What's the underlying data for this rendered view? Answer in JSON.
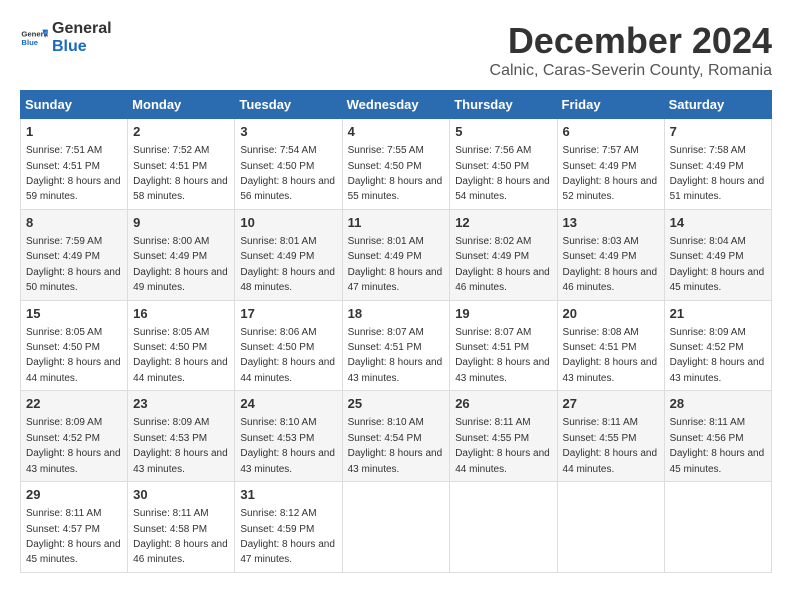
{
  "header": {
    "logo_general": "General",
    "logo_blue": "Blue",
    "month_title": "December 2024",
    "subtitle": "Calnic, Caras-Severin County, Romania"
  },
  "days_of_week": [
    "Sunday",
    "Monday",
    "Tuesday",
    "Wednesday",
    "Thursday",
    "Friday",
    "Saturday"
  ],
  "weeks": [
    [
      {
        "day": "1",
        "sunrise": "Sunrise: 7:51 AM",
        "sunset": "Sunset: 4:51 PM",
        "daylight": "Daylight: 8 hours and 59 minutes."
      },
      {
        "day": "2",
        "sunrise": "Sunrise: 7:52 AM",
        "sunset": "Sunset: 4:51 PM",
        "daylight": "Daylight: 8 hours and 58 minutes."
      },
      {
        "day": "3",
        "sunrise": "Sunrise: 7:54 AM",
        "sunset": "Sunset: 4:50 PM",
        "daylight": "Daylight: 8 hours and 56 minutes."
      },
      {
        "day": "4",
        "sunrise": "Sunrise: 7:55 AM",
        "sunset": "Sunset: 4:50 PM",
        "daylight": "Daylight: 8 hours and 55 minutes."
      },
      {
        "day": "5",
        "sunrise": "Sunrise: 7:56 AM",
        "sunset": "Sunset: 4:50 PM",
        "daylight": "Daylight: 8 hours and 54 minutes."
      },
      {
        "day": "6",
        "sunrise": "Sunrise: 7:57 AM",
        "sunset": "Sunset: 4:49 PM",
        "daylight": "Daylight: 8 hours and 52 minutes."
      },
      {
        "day": "7",
        "sunrise": "Sunrise: 7:58 AM",
        "sunset": "Sunset: 4:49 PM",
        "daylight": "Daylight: 8 hours and 51 minutes."
      }
    ],
    [
      {
        "day": "8",
        "sunrise": "Sunrise: 7:59 AM",
        "sunset": "Sunset: 4:49 PM",
        "daylight": "Daylight: 8 hours and 50 minutes."
      },
      {
        "day": "9",
        "sunrise": "Sunrise: 8:00 AM",
        "sunset": "Sunset: 4:49 PM",
        "daylight": "Daylight: 8 hours and 49 minutes."
      },
      {
        "day": "10",
        "sunrise": "Sunrise: 8:01 AM",
        "sunset": "Sunset: 4:49 PM",
        "daylight": "Daylight: 8 hours and 48 minutes."
      },
      {
        "day": "11",
        "sunrise": "Sunrise: 8:01 AM",
        "sunset": "Sunset: 4:49 PM",
        "daylight": "Daylight: 8 hours and 47 minutes."
      },
      {
        "day": "12",
        "sunrise": "Sunrise: 8:02 AM",
        "sunset": "Sunset: 4:49 PM",
        "daylight": "Daylight: 8 hours and 46 minutes."
      },
      {
        "day": "13",
        "sunrise": "Sunrise: 8:03 AM",
        "sunset": "Sunset: 4:49 PM",
        "daylight": "Daylight: 8 hours and 46 minutes."
      },
      {
        "day": "14",
        "sunrise": "Sunrise: 8:04 AM",
        "sunset": "Sunset: 4:49 PM",
        "daylight": "Daylight: 8 hours and 45 minutes."
      }
    ],
    [
      {
        "day": "15",
        "sunrise": "Sunrise: 8:05 AM",
        "sunset": "Sunset: 4:50 PM",
        "daylight": "Daylight: 8 hours and 44 minutes."
      },
      {
        "day": "16",
        "sunrise": "Sunrise: 8:05 AM",
        "sunset": "Sunset: 4:50 PM",
        "daylight": "Daylight: 8 hours and 44 minutes."
      },
      {
        "day": "17",
        "sunrise": "Sunrise: 8:06 AM",
        "sunset": "Sunset: 4:50 PM",
        "daylight": "Daylight: 8 hours and 44 minutes."
      },
      {
        "day": "18",
        "sunrise": "Sunrise: 8:07 AM",
        "sunset": "Sunset: 4:51 PM",
        "daylight": "Daylight: 8 hours and 43 minutes."
      },
      {
        "day": "19",
        "sunrise": "Sunrise: 8:07 AM",
        "sunset": "Sunset: 4:51 PM",
        "daylight": "Daylight: 8 hours and 43 minutes."
      },
      {
        "day": "20",
        "sunrise": "Sunrise: 8:08 AM",
        "sunset": "Sunset: 4:51 PM",
        "daylight": "Daylight: 8 hours and 43 minutes."
      },
      {
        "day": "21",
        "sunrise": "Sunrise: 8:09 AM",
        "sunset": "Sunset: 4:52 PM",
        "daylight": "Daylight: 8 hours and 43 minutes."
      }
    ],
    [
      {
        "day": "22",
        "sunrise": "Sunrise: 8:09 AM",
        "sunset": "Sunset: 4:52 PM",
        "daylight": "Daylight: 8 hours and 43 minutes."
      },
      {
        "day": "23",
        "sunrise": "Sunrise: 8:09 AM",
        "sunset": "Sunset: 4:53 PM",
        "daylight": "Daylight: 8 hours and 43 minutes."
      },
      {
        "day": "24",
        "sunrise": "Sunrise: 8:10 AM",
        "sunset": "Sunset: 4:53 PM",
        "daylight": "Daylight: 8 hours and 43 minutes."
      },
      {
        "day": "25",
        "sunrise": "Sunrise: 8:10 AM",
        "sunset": "Sunset: 4:54 PM",
        "daylight": "Daylight: 8 hours and 43 minutes."
      },
      {
        "day": "26",
        "sunrise": "Sunrise: 8:11 AM",
        "sunset": "Sunset: 4:55 PM",
        "daylight": "Daylight: 8 hours and 44 minutes."
      },
      {
        "day": "27",
        "sunrise": "Sunrise: 8:11 AM",
        "sunset": "Sunset: 4:55 PM",
        "daylight": "Daylight: 8 hours and 44 minutes."
      },
      {
        "day": "28",
        "sunrise": "Sunrise: 8:11 AM",
        "sunset": "Sunset: 4:56 PM",
        "daylight": "Daylight: 8 hours and 45 minutes."
      }
    ],
    [
      {
        "day": "29",
        "sunrise": "Sunrise: 8:11 AM",
        "sunset": "Sunset: 4:57 PM",
        "daylight": "Daylight: 8 hours and 45 minutes."
      },
      {
        "day": "30",
        "sunrise": "Sunrise: 8:11 AM",
        "sunset": "Sunset: 4:58 PM",
        "daylight": "Daylight: 8 hours and 46 minutes."
      },
      {
        "day": "31",
        "sunrise": "Sunrise: 8:12 AM",
        "sunset": "Sunset: 4:59 PM",
        "daylight": "Daylight: 8 hours and 47 minutes."
      },
      null,
      null,
      null,
      null
    ]
  ]
}
